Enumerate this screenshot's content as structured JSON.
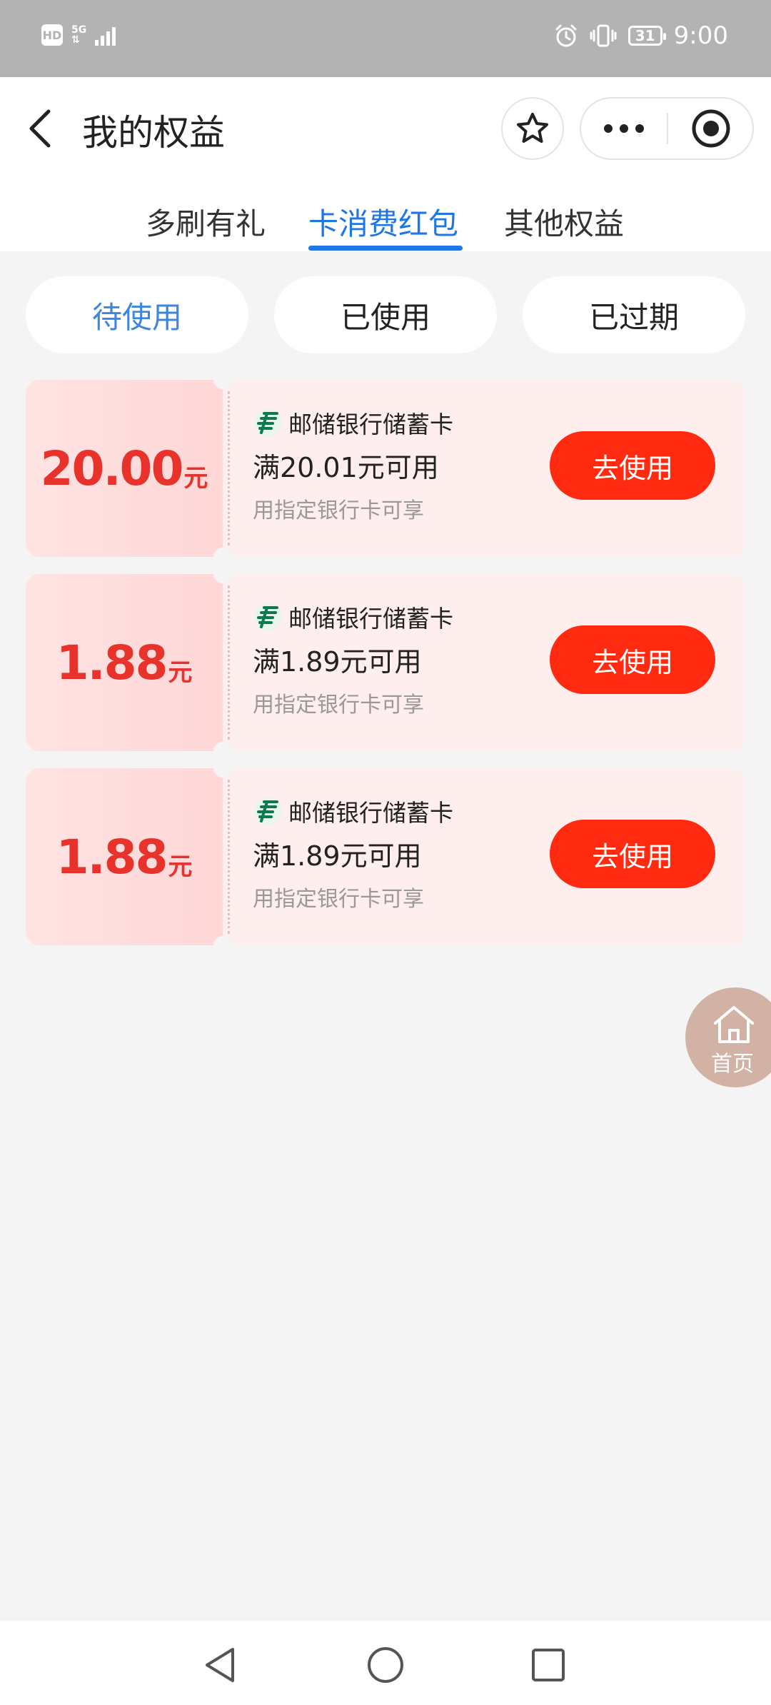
{
  "status_bar": {
    "hd": "HD",
    "network_top": "5G",
    "network_bottom": "⇅",
    "battery": "31",
    "time": "9:00"
  },
  "header": {
    "title": "我的权益",
    "icons": [
      "back-arrow-icon",
      "star-icon",
      "more-icon",
      "target-icon"
    ]
  },
  "tabs": [
    {
      "label": "多刷有礼",
      "active": false
    },
    {
      "label": "卡消费红包",
      "active": true
    },
    {
      "label": "其他权益",
      "active": false
    }
  ],
  "filters": [
    {
      "label": "待使用",
      "active": true
    },
    {
      "label": "已使用",
      "active": false
    },
    {
      "label": "已过期",
      "active": false
    }
  ],
  "coupons": [
    {
      "amount": "20.00",
      "unit": "元",
      "bank": "邮储银行储蓄卡",
      "condition": "满20.01元可用",
      "note": "用指定银行卡可享",
      "button": "去使用"
    },
    {
      "amount": "1.88",
      "unit": "元",
      "bank": "邮储银行储蓄卡",
      "condition": "满1.89元可用",
      "note": "用指定银行卡可享",
      "button": "去使用"
    },
    {
      "amount": "1.88",
      "unit": "元",
      "bank": "邮储银行储蓄卡",
      "condition": "满1.89元可用",
      "note": "用指定银行卡可享",
      "button": "去使用"
    }
  ],
  "home_fab": {
    "label": "首页"
  },
  "colors": {
    "accent_blue": "#1f77e6",
    "coupon_red": "#e8322c",
    "button_red": "#ff2a0f",
    "bank_green": "#0b7a4e"
  }
}
